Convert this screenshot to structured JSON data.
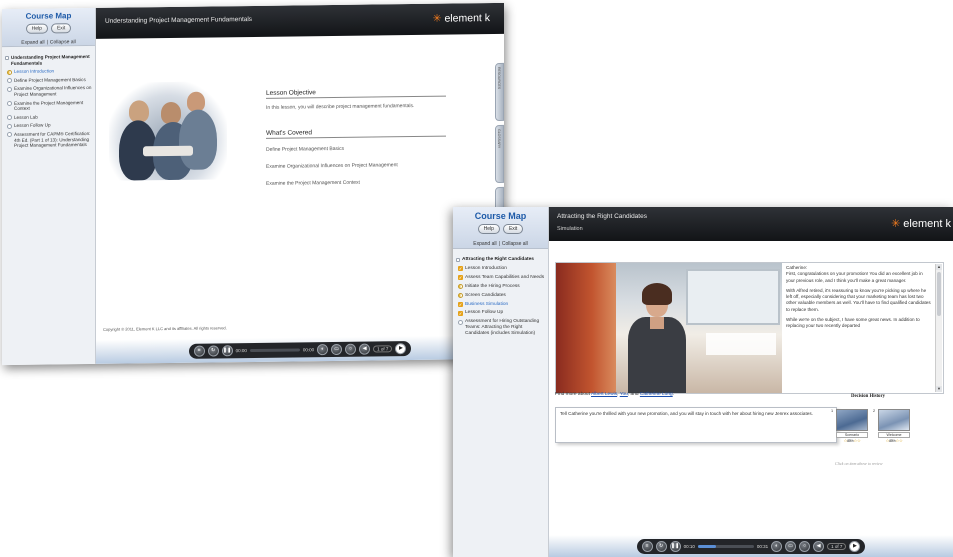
{
  "brand": {
    "logo_text": "element k",
    "logo_accent": "#f27b1f"
  },
  "window1": {
    "sidebar": {
      "title": "Course Map",
      "help_label": "Help",
      "exit_label": "Exit",
      "expand_all": "Expand all",
      "collapse_all": "Collapse all",
      "root_title": "Understanding Project Management Fundamentals",
      "items": [
        {
          "label": "Lesson Introduction",
          "state": "in-progress",
          "active": true
        },
        {
          "label": "Define Project Management Basics",
          "state": "not-started"
        },
        {
          "label": "Examine Organizational Influences on Project Management",
          "state": "not-started"
        },
        {
          "label": "Examine the Project Management Context",
          "state": "not-started"
        },
        {
          "label": "Lesson Lab",
          "state": "not-started"
        },
        {
          "label": "Lesson Follow Up",
          "state": "not-started"
        },
        {
          "label": "Assessment for CAPM® Certification: 4th Ed. (Part 1 of 13): Understanding Project Management Fundamentals",
          "state": "not-started"
        }
      ]
    },
    "header": {
      "title": "Understanding Project Management Fundamentals"
    },
    "content": {
      "objective_heading": "Lesson Objective",
      "objective_text": "In this lesson, you will describe project management fundamentals.",
      "covered_heading": "What's Covered",
      "covered_items": [
        "Define Project Management Basics",
        "Examine Organizational Influences on Project Management",
        "Examine the Project Management Context"
      ],
      "copyright": "Copyright © 2011, Element K LLC and its affiliates. All rights reserved."
    },
    "side_tabs": [
      "RESOURCES",
      "GLOSSARY"
    ],
    "player": {
      "elapsed": "00:00",
      "total": "00:00",
      "page": "1 of 7",
      "progress": 0
    }
  },
  "window2": {
    "sidebar": {
      "title": "Course Map",
      "help_label": "Help",
      "exit_label": "Exit",
      "expand_all": "Expand all",
      "collapse_all": "Collapse all",
      "root_title": "Attracting the Right Candidates",
      "items": [
        {
          "label": "Lesson Introduction",
          "state": "complete"
        },
        {
          "label": "Assess Team Capabilities and Needs",
          "state": "complete"
        },
        {
          "label": "Initiate the Hiring Process",
          "state": "in-progress"
        },
        {
          "label": "Screen Candidates",
          "state": "in-progress"
        },
        {
          "label": "Business Simulation",
          "state": "complete",
          "active": true
        },
        {
          "label": "Lesson Follow Up",
          "state": "complete"
        },
        {
          "label": "Assessment for Hiring Outstanding Teams: Attracting the Right Candidates (includes Simulation)",
          "state": "not-started"
        }
      ]
    },
    "header": {
      "title": "Attracting the Right Candidates",
      "subtitle": "Simulation"
    },
    "dialog": {
      "speaker": "Catherine:",
      "paragraphs": [
        "First, congratulations on your promotion! You did an excellent job in your previous role, and I think you'll make a great manager.",
        "With Alfred retired, it's reassuring to know you're picking up where he left off, especially considering that your marketing team has lost two other valuable members as well. You'll have to find qualified candidates to replace them.",
        "While we're on the subject, I have some great news. In addition to replacing your two recently departed"
      ]
    },
    "find_more": {
      "prefix": "Find more about",
      "link1": "Albert Lewis",
      "sep1": ",",
      "link2": "You",
      "sep2": ", and",
      "link3": "Catherine Long",
      "suffix": "."
    },
    "response": "Tell Catherine you're thrilled with your new promotion, and you will stay in touch with her about hiring new Jenrex associates.",
    "decision_history": {
      "title": "Decision History",
      "cards": [
        {
          "num": "1",
          "caption": "Scenario",
          "score": "85%"
        },
        {
          "num": "2",
          "caption": "Welcome",
          "score": "85%"
        }
      ],
      "hint": "Click on item above to review"
    },
    "player": {
      "elapsed": "00:10",
      "total": "00:31",
      "page": "1 of 7",
      "progress": 0.32
    }
  }
}
